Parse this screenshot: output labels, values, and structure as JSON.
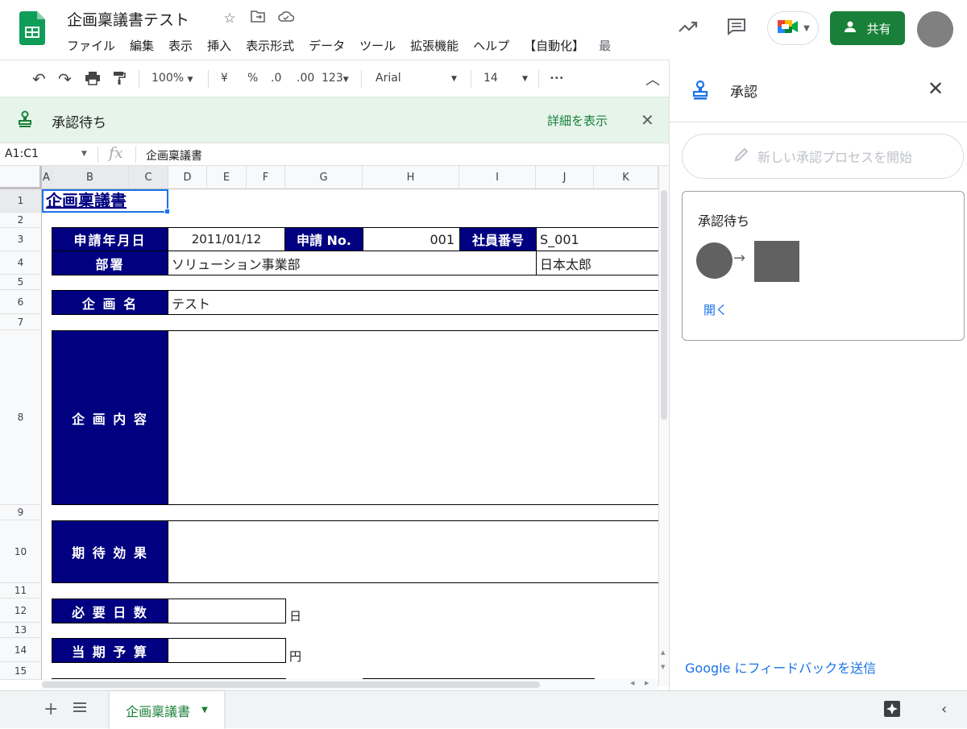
{
  "header": {
    "title": "企画稟議書テスト",
    "menu": [
      "ファイル",
      "編集",
      "表示",
      "挿入",
      "表示形式",
      "データ",
      "ツール",
      "拡張機能",
      "ヘルプ",
      "【自動化】",
      "最"
    ],
    "share_label": "共有"
  },
  "toolbar": {
    "zoom": "100%",
    "currency": "¥",
    "percent": "%",
    "dec_decrease": ".0",
    "dec_increase": ".00",
    "number_format": "123",
    "font": "Arial",
    "font_size": "14",
    "more": "•••"
  },
  "banner": {
    "title": "承認待ち",
    "details_link": "詳細を表示"
  },
  "formula_bar": {
    "cell_ref": "A1:C1",
    "fx": "fx",
    "content": "企画稟議書"
  },
  "columns": [
    "A",
    "B",
    "C",
    "D",
    "E",
    "F",
    "G",
    "H",
    "I",
    "J",
    "K"
  ],
  "rows": [
    "1",
    "2",
    "3",
    "4",
    "5",
    "6",
    "7",
    "8",
    "9",
    "10",
    "11",
    "12",
    "13",
    "14",
    "15"
  ],
  "sheet": {
    "title": "企画稟議書",
    "apply_date_label": "申請年月日",
    "apply_date": "2011/01/12",
    "apply_no_label": "申請 No.",
    "apply_no": "001",
    "emp_no_label": "社員番号",
    "emp_no": "S_001",
    "dept_label": "部署",
    "dept": "ソリューション事業部",
    "name": "日本太郎",
    "plan_name_label": "企 画 名",
    "plan_name": "テスト",
    "plan_content_label": "企 画 内 容",
    "effect_label": "期 待 効 果",
    "days_label": "必 要 日 数",
    "days_unit": "日",
    "budget_label": "当 期 予 算",
    "budget_unit": "円"
  },
  "panel": {
    "title": "承認",
    "new_process": "新しい承認プロセスを開始",
    "card_title": "承認待ち",
    "open_link": "開く",
    "feedback_brand": "Google",
    "feedback_text": "にフィードバックを送信"
  },
  "bottom": {
    "sheet_tab": "企画稟議書"
  },
  "colors": {
    "navy": "#000080",
    "green": "#188038",
    "banner_bg": "#e6f4ea",
    "link_blue": "#1a73e8"
  }
}
